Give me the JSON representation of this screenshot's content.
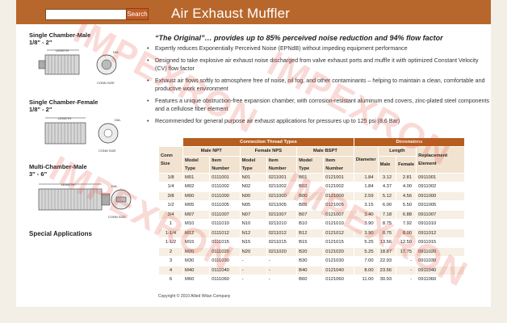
{
  "header": {
    "search_placeholder": "",
    "search_button": "Search",
    "title": "Air Exhaust Muffler"
  },
  "sidebar": {
    "sections": [
      {
        "title_line1": "Single Chamber-Male",
        "title_line2": "1/8\" - 2\"",
        "dims": [
          "LENGTH",
          "DIA.",
          "CONN SIZE"
        ]
      },
      {
        "title_line1": "Single Chamber-Female",
        "title_line2": "1/8\" - 2\"",
        "dims": [
          "LENGTH",
          "DIA.",
          "CONN SIZE"
        ]
      },
      {
        "title_line1": "Multi-Chamber-Male",
        "title_line2": "3\" - 6\"",
        "dims": [
          "LENGTH",
          "DIA.",
          "CONN SIZE"
        ]
      }
    ],
    "special": "Special Applications"
  },
  "main": {
    "tagline": "“The Original”… provides up to 85% perceived noise reduction and 94% flow factor",
    "bullets": [
      "Expertly reduces Exponentially Perceived Noise (EPNdB) without impeding equipment performance",
      "Designed to take explosive air exhaust noise discharged from valve exhaust ports and muffle it with optimized Constant Velocity (CV) flow factor",
      "Exhaust air flows softly to atmosphere free of noise, oil fog, and other contaminants – helping to maintain a clean, comfortable and productive work environment",
      "Features a unique obstruction-free expansion chamber, with corrosion-resistant aluminum end covers, zinc-plated steel components and a cellulose fiber element",
      "Recommended for general purpose air exhaust applications for pressures up to 125 psi (8.6 Bar)"
    ]
  },
  "table": {
    "group_header_threads": "Connection Thread Types",
    "group_header_dims": "Dimensions",
    "col_conn": "Conn Size",
    "col_male_npt": "Male NPT",
    "col_female_nps": "Female NPS",
    "col_male_bspt": "Male BSPT",
    "col_diameter": "Diameter",
    "col_length": "Length",
    "col_replacement": "Replacement Element",
    "sub_model_type": "Model Type",
    "sub_item_number": "Item Number",
    "sub_male": "Male",
    "sub_female": "Female",
    "rows": [
      [
        "1/8",
        "M01",
        "0111001",
        "N01",
        "0211001",
        "B01",
        "0121001",
        "1.84",
        "3.12",
        "2.81",
        "0911001"
      ],
      [
        "1/4",
        "M02",
        "0111002",
        "N02",
        "0211002",
        "B02",
        "0121002",
        "1.84",
        "4.37",
        "4.00",
        "0911002"
      ],
      [
        "3/8",
        "M00",
        "0111000",
        "N00",
        "0211000",
        "B00",
        "0121000",
        "2.59",
        "5.12",
        "4.56",
        "0911000"
      ],
      [
        "1/2",
        "M05",
        "0111005",
        "N05",
        "0211005",
        "B05",
        "0121005",
        "3.15",
        "6.00",
        "5.50",
        "0911005"
      ],
      [
        "3/4",
        "M07",
        "0111007",
        "N07",
        "0211007",
        "B07",
        "0121007",
        "3.40",
        "7.18",
        "6.88",
        "0911007"
      ],
      [
        "1",
        "M10",
        "0111010",
        "N10",
        "0211010",
        "B10",
        "0121010",
        "3.90",
        "8.75",
        "7.92",
        "0911010"
      ],
      [
        "1-1/4",
        "M12",
        "0111012",
        "N12",
        "0211012",
        "B12",
        "0121012",
        "3.90",
        "8.75",
        "8.00",
        "0911012"
      ],
      [
        "1-1/2",
        "M15",
        "0111015",
        "N15",
        "0211015",
        "B15",
        "0121015",
        "5.25",
        "13.56",
        "12.50",
        "0911015"
      ],
      [
        "2",
        "M20",
        "0111020",
        "N20",
        "0211020",
        "B20",
        "0121020",
        "5.25",
        "18.87",
        "17.75",
        "0911020"
      ],
      [
        "3",
        "M30",
        "0111030",
        "-",
        "-",
        "B30",
        "0121030",
        "7.00",
        "22.93",
        "-",
        "0911030"
      ],
      [
        "4",
        "M40",
        "0111040",
        "-",
        "-",
        "B40",
        "0121040",
        "8.00",
        "23.56",
        "-",
        "0911040"
      ],
      [
        "6",
        "M60",
        "0111060",
        "-",
        "-",
        "B60",
        "0121060",
        "11.00",
        "30.93",
        "-",
        "0911060"
      ]
    ]
  },
  "footer": {
    "copyright": "Copyright © 2010 Allied Witan Company"
  },
  "watermark": "IMPEXRON",
  "colors": {
    "header_bar": "#b8672c",
    "table_header": "#b55e1f",
    "page_bg": "#f3efe7",
    "watermark": "#e14637"
  }
}
